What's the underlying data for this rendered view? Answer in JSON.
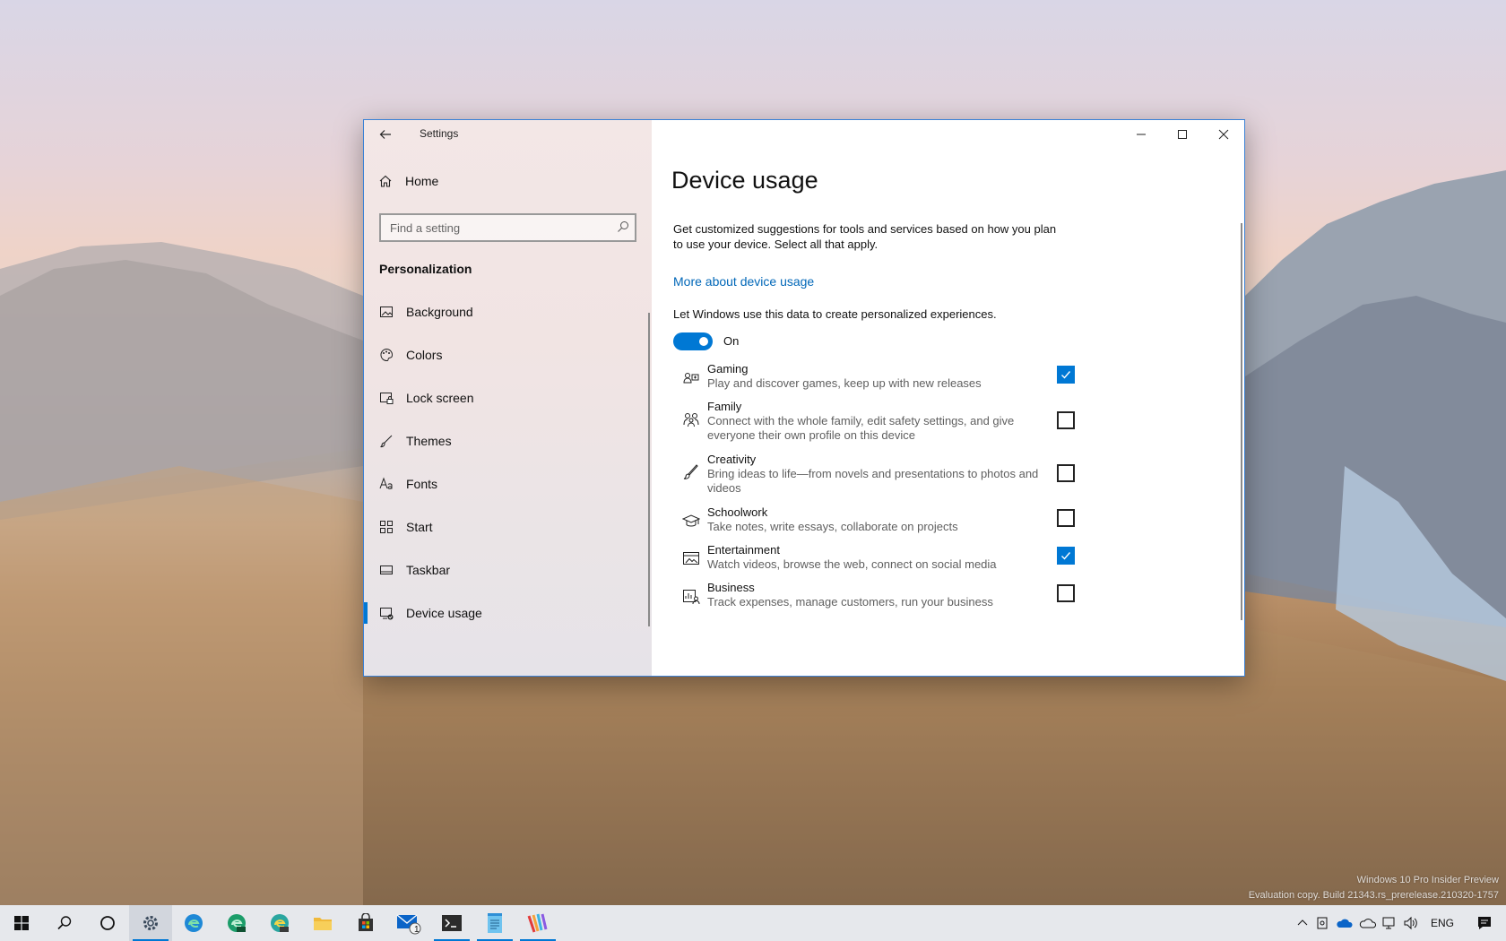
{
  "window": {
    "app_title": "Settings"
  },
  "sidebar": {
    "home_label": "Home",
    "search_placeholder": "Find a setting",
    "section_title": "Personalization",
    "items": [
      {
        "label": "Background",
        "icon": "image-icon"
      },
      {
        "label": "Colors",
        "icon": "palette-icon"
      },
      {
        "label": "Lock screen",
        "icon": "lock-screen-icon"
      },
      {
        "label": "Themes",
        "icon": "brush-icon"
      },
      {
        "label": "Fonts",
        "icon": "font-icon"
      },
      {
        "label": "Start",
        "icon": "start-grid-icon"
      },
      {
        "label": "Taskbar",
        "icon": "taskbar-icon"
      },
      {
        "label": "Device usage",
        "icon": "device-usage-icon",
        "active": true
      }
    ]
  },
  "main": {
    "title": "Device usage",
    "description": "Get customized suggestions for tools and services based on how you plan to use your device. Select all that apply.",
    "more_link": "More about device usage",
    "toggle_label": "Let Windows use this data to create personalized experiences.",
    "toggle_state": "On",
    "toggle_on": true,
    "options": [
      {
        "title": "Gaming",
        "desc": "Play and discover games, keep up with new releases",
        "checked": true,
        "icon": "gaming-icon"
      },
      {
        "title": "Family",
        "desc": "Connect with the whole family, edit safety settings, and give everyone their own profile on this device",
        "checked": false,
        "icon": "family-icon"
      },
      {
        "title": "Creativity",
        "desc": "Bring ideas to life—from novels and presentations to photos and videos",
        "checked": false,
        "icon": "creativity-icon"
      },
      {
        "title": "Schoolwork",
        "desc": "Take notes, write essays, collaborate on projects",
        "checked": false,
        "icon": "schoolwork-icon"
      },
      {
        "title": "Entertainment",
        "desc": "Watch videos, browse the web, connect on social media",
        "checked": true,
        "icon": "entertainment-icon"
      },
      {
        "title": "Business",
        "desc": "Track expenses, manage customers, run your business",
        "checked": false,
        "icon": "business-icon"
      }
    ]
  },
  "desktop": {
    "watermark_line1": "Windows 10 Pro Insider Preview",
    "watermark_line2": "Evaluation copy. Build 21343.rs_prerelease.210320-1757"
  },
  "taskbar": {
    "language": "ENG",
    "mail_badge": "1",
    "apps": [
      "start-icon",
      "search-icon",
      "cortana-icon",
      "settings-icon",
      "edge-icon",
      "edge-dev-icon",
      "edge-canary-icon",
      "file-explorer-icon",
      "store-icon",
      "mail-icon",
      "terminal-icon",
      "notepad-icon",
      "paint-icon"
    ]
  },
  "colors": {
    "accent": "#0078d4",
    "link": "#0067b8"
  }
}
